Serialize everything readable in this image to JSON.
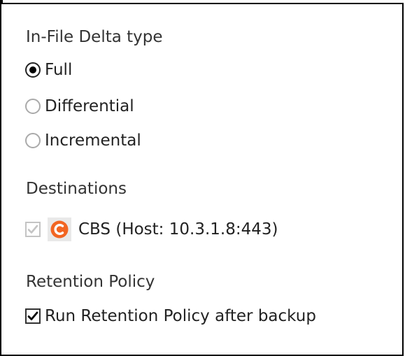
{
  "delta": {
    "title": "In-File Delta type",
    "options": [
      {
        "label": "Full",
        "checked": true
      },
      {
        "label": "Differential",
        "checked": false
      },
      {
        "label": "Incremental",
        "checked": false
      }
    ]
  },
  "destinations": {
    "title": "Destinations",
    "item": {
      "checked": true,
      "enabled": false,
      "logo_icon": "cbs-logo-icon",
      "logo_color": "#f26522",
      "label": "CBS (Host: 10.3.1.8:443)"
    }
  },
  "retention": {
    "title": "Retention Policy",
    "option": {
      "label": "Run Retention Policy after backup",
      "checked": true
    }
  }
}
